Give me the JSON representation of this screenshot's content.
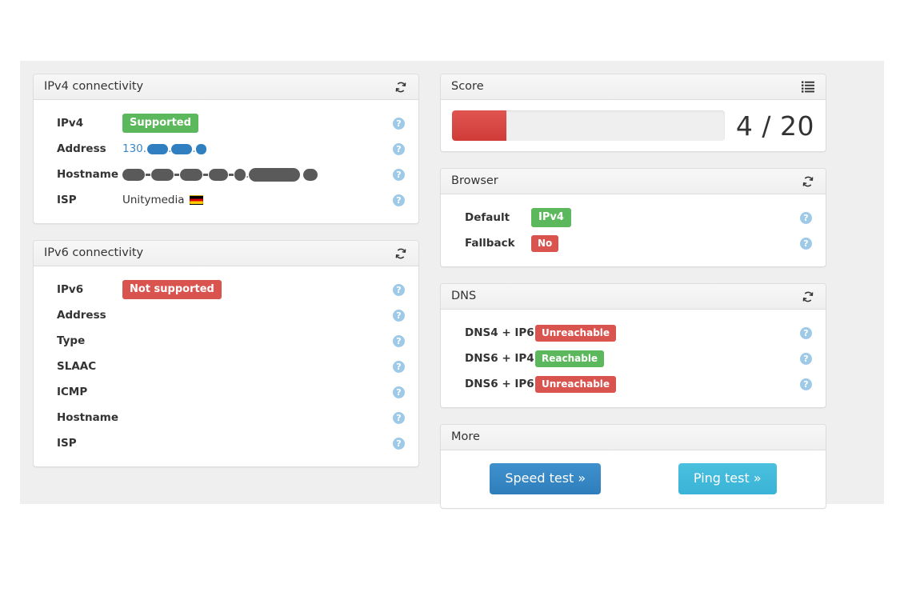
{
  "panels": {
    "ipv4": {
      "title": "IPv4 connectivity",
      "refresh_icon": "refresh-icon",
      "rows": [
        {
          "label": "IPv4",
          "badge": "Supported",
          "badge_type": "success",
          "help": "?"
        },
        {
          "label": "Address",
          "value_prefix": "130.",
          "redacted": "blue",
          "help": "?"
        },
        {
          "label": "Hostname",
          "redacted": "gray",
          "help": "?"
        },
        {
          "label": "ISP",
          "value": "Unitymedia",
          "flag": "flag-de",
          "help": "?"
        }
      ]
    },
    "ipv6": {
      "title": "IPv6 connectivity",
      "refresh_icon": "refresh-icon",
      "rows": [
        {
          "label": "IPv6",
          "badge": "Not supported",
          "badge_type": "danger",
          "help": "?"
        },
        {
          "label": "Address",
          "value": "",
          "help": "?"
        },
        {
          "label": "Type",
          "value": "",
          "help": "?"
        },
        {
          "label": "SLAAC",
          "value": "",
          "help": "?"
        },
        {
          "label": "ICMP",
          "value": "",
          "help": "?"
        },
        {
          "label": "Hostname",
          "value": "",
          "help": "?"
        },
        {
          "label": "ISP",
          "value": "",
          "help": "?"
        }
      ]
    },
    "score": {
      "title": "Score",
      "list_icon": "list-icon",
      "value": 4,
      "max": 20,
      "text": "4 / 20",
      "percent": 20,
      "bar_color": "#d9534f"
    },
    "browser": {
      "title": "Browser",
      "refresh_icon": "refresh-icon",
      "rows": [
        {
          "label": "Default",
          "badge": "IPv4",
          "badge_type": "success",
          "help": "?"
        },
        {
          "label": "Fallback",
          "badge": "No",
          "badge_type": "danger",
          "help": "?"
        }
      ]
    },
    "dns": {
      "title": "DNS",
      "refresh_icon": "refresh-icon",
      "rows": [
        {
          "label": "DNS4 + IP6",
          "badge": "Unreachable",
          "badge_type": "danger",
          "help": "?"
        },
        {
          "label": "DNS6 + IP4",
          "badge": "Reachable",
          "badge_type": "success",
          "help": "?"
        },
        {
          "label": "DNS6 + IP6",
          "badge": "Unreachable",
          "badge_type": "danger",
          "help": "?"
        }
      ]
    },
    "more": {
      "title": "More",
      "speed_test_label": "Speed test »",
      "ping_test_label": "Ping test »"
    }
  },
  "colors": {
    "success": "#5cb85c",
    "danger": "#d9534f",
    "primary": "#2e7ebb",
    "info": "#39b3d7",
    "help": "#9ecae8",
    "page_bg": "#efefef"
  }
}
